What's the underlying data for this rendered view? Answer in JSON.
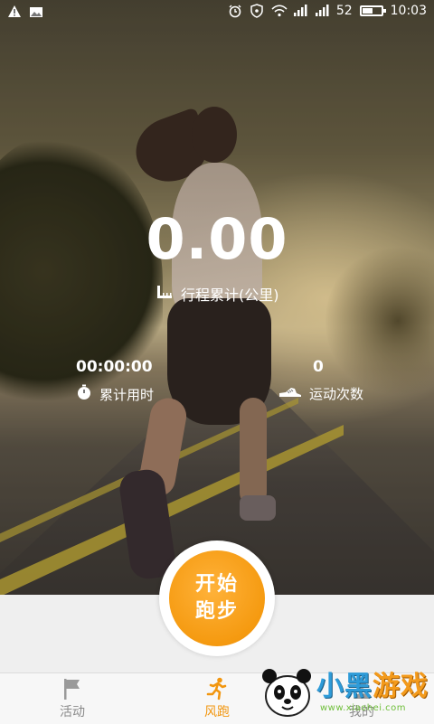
{
  "status_bar": {
    "battery_level": "52",
    "time": "10:03"
  },
  "stats": {
    "distance_value": "0.00",
    "distance_label": "行程累计(公里)",
    "time_value": "00:00:00",
    "time_label": "累计用时",
    "count_value": "0",
    "count_label": "运动次数"
  },
  "start_button": {
    "line1": "开始",
    "line2": "跑步"
  },
  "bottom_nav": {
    "items": [
      {
        "label": "活动",
        "icon": "flag-icon",
        "active": false
      },
      {
        "label": "风跑",
        "icon": "runner-icon",
        "active": true
      },
      {
        "label": "我的",
        "icon": "person-icon",
        "active": false
      }
    ],
    "active_color": "#f2960f",
    "inactive_color": "#8a8a8a"
  },
  "watermark": {
    "title_part1": "小黑",
    "title_part2": "游戏",
    "url": "www.xiaohei.com"
  },
  "colors": {
    "accent": "#f59a10",
    "background": "#efefef"
  }
}
